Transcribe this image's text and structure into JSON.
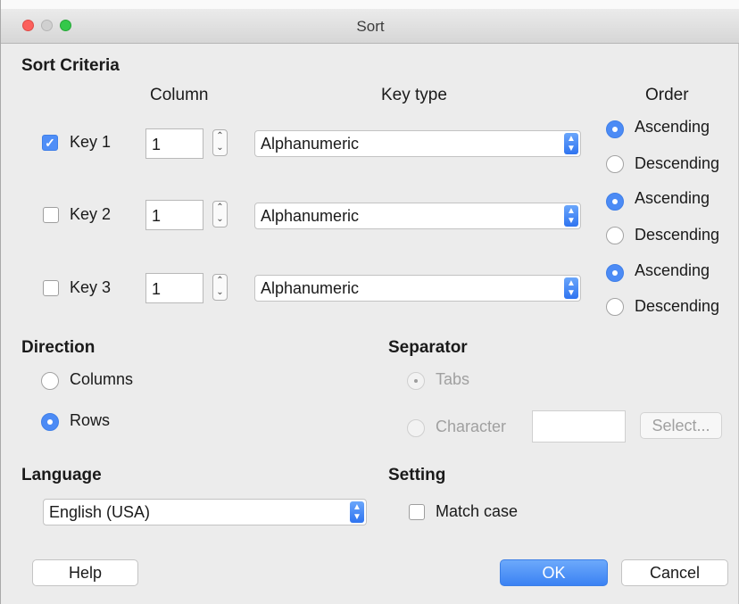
{
  "window": {
    "title": "Sort"
  },
  "sort_criteria": {
    "heading": "Sort Criteria",
    "column_header": "Column",
    "key_type_header": "Key type",
    "order_header": "Order",
    "keys": [
      {
        "label": "Key 1",
        "checked": true,
        "column": "1",
        "key_type": "Alphanumeric",
        "ascending": "Ascending",
        "descending": "Descending",
        "order_selected": "Ascending"
      },
      {
        "label": "Key 2",
        "checked": false,
        "column": "1",
        "key_type": "Alphanumeric",
        "ascending": "Ascending",
        "descending": "Descending",
        "order_selected": "Ascending"
      },
      {
        "label": "Key 3",
        "checked": false,
        "column": "1",
        "key_type": "Alphanumeric",
        "ascending": "Ascending",
        "descending": "Descending",
        "order_selected": "Ascending"
      }
    ]
  },
  "direction": {
    "heading": "Direction",
    "columns": "Columns",
    "rows": "Rows",
    "selected": "Rows"
  },
  "separator": {
    "heading": "Separator",
    "tabs": "Tabs",
    "character": "Character",
    "character_value": "",
    "select_button": "Select..."
  },
  "language": {
    "heading": "Language",
    "value": "English (USA)"
  },
  "setting": {
    "heading": "Setting",
    "match_case": "Match case",
    "match_case_checked": false
  },
  "buttons": {
    "help": "Help",
    "ok": "OK",
    "cancel": "Cancel"
  },
  "colors": {
    "accent": "#4c8bf5",
    "window_bg": "#ececec",
    "close": "#fc605c",
    "minimize": "#d0d0d0",
    "zoom": "#34c84a"
  }
}
